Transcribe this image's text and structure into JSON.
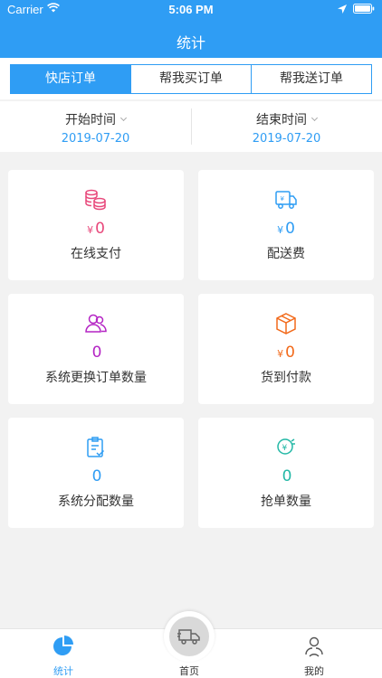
{
  "status_bar": {
    "carrier": "Carrier",
    "time": "5:06 PM"
  },
  "nav": {
    "title": "统计"
  },
  "segments": [
    {
      "label": "快店订单",
      "active": true
    },
    {
      "label": "帮我买订单",
      "active": false
    },
    {
      "label": "帮我送订单",
      "active": false
    }
  ],
  "date_filter": {
    "start": {
      "label": "开始时间",
      "value": "2019-07-20"
    },
    "end": {
      "label": "结束时间",
      "value": "2019-07-20"
    }
  },
  "stats": [
    {
      "icon": "coins-icon",
      "currency": "¥",
      "value": "0",
      "label": "在线支付",
      "color": "#e8487b"
    },
    {
      "icon": "delivery-truck-icon",
      "currency": "¥",
      "value": "0",
      "label": "配送费",
      "color": "#2f9df4"
    },
    {
      "icon": "users-icon",
      "currency": "",
      "value": "0",
      "label": "系统更换订单数量",
      "color": "#b424c4"
    },
    {
      "icon": "package-icon",
      "currency": "¥",
      "value": "0",
      "label": "货到付款",
      "color": "#f26a1b"
    },
    {
      "icon": "clipboard-check-icon",
      "currency": "",
      "value": "0",
      "label": "系统分配数量",
      "color": "#2f9df4"
    },
    {
      "icon": "grab-order-icon",
      "currency": "",
      "value": "0",
      "label": "抢单数量",
      "color": "#23b8a6"
    }
  ],
  "tabbar": {
    "items": [
      {
        "label": "统计",
        "icon": "pie-chart-icon",
        "active": true
      },
      {
        "label": "首页",
        "icon": "truck-icon",
        "active": false
      },
      {
        "label": "我的",
        "icon": "profile-icon",
        "active": false
      }
    ]
  },
  "colors": {
    "primary": "#2f9df4",
    "background": "#f2f2f2"
  }
}
